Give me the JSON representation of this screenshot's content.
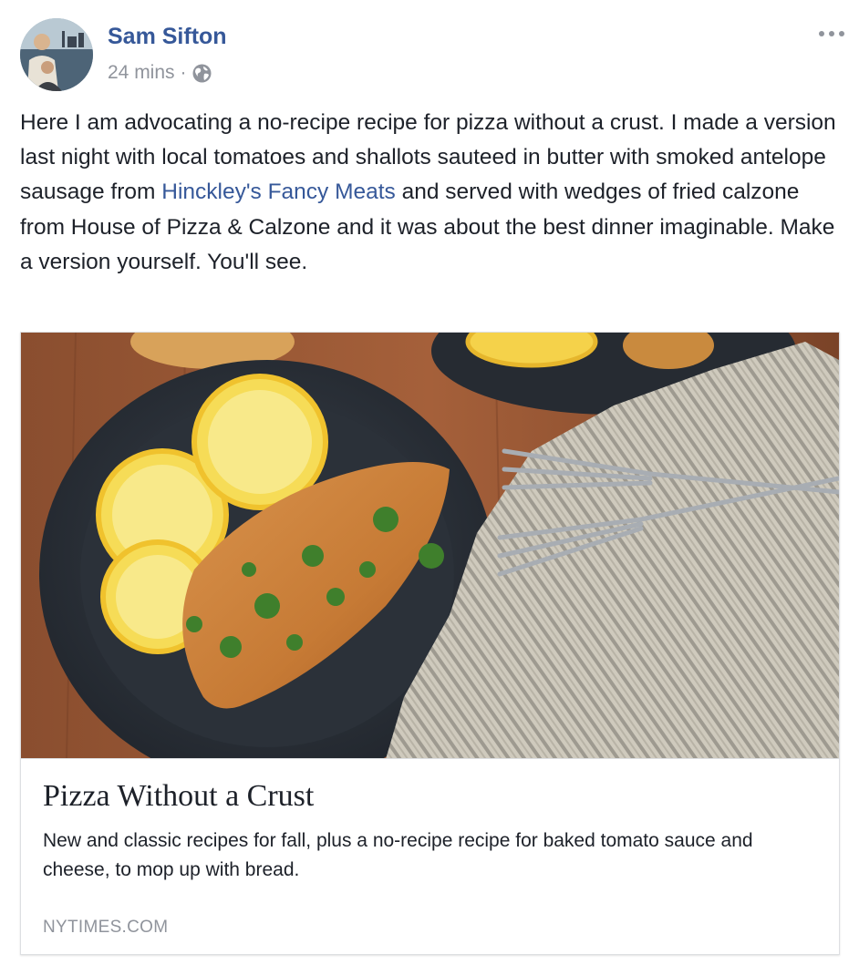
{
  "post": {
    "author": "Sam Sifton",
    "timestamp": "24 mins",
    "separator": "·",
    "privacy_icon": "globe-icon",
    "menu_icon": "more-options-icon",
    "text_before_link": "Here I am advocating a no-recipe recipe for pizza without a crust. I made a version last night with local tomatoes and shallots sauteed in butter with smoked antelope sausage from ",
    "link_text": "Hinckley's Fancy Meats",
    "text_after_link": " and served with wedges of fried calzone from House of Pizza & Calzone and it was about the best dinner imaginable. Make a version yourself. You'll see."
  },
  "link_card": {
    "title": "Pizza Without a Crust",
    "description": "New and classic recipes for fall, plus a no-recipe recipe for baked tomato sauce and cheese, to mop up with bread.",
    "domain": "NYTIMES.COM"
  },
  "colors": {
    "link": "#365899",
    "text": "#1d2129",
    "meta": "#90949c"
  }
}
